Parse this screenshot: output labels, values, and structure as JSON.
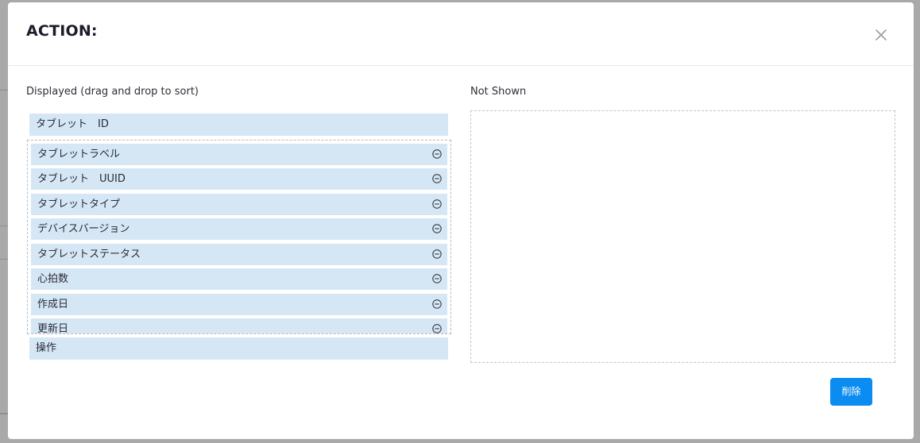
{
  "modal": {
    "title": "ACTION:",
    "close_icon": "close-icon"
  },
  "displayed": {
    "label": "Displayed (drag and drop to sort)",
    "fixed_top": "タブレット　ID",
    "items": [
      {
        "label": "タブレットラベル"
      },
      {
        "label": "タブレット　UUID"
      },
      {
        "label": "タブレットタイプ"
      },
      {
        "label": "デバイスバージョン"
      },
      {
        "label": "タブレットステータス"
      },
      {
        "label": "心拍数"
      },
      {
        "label": "作成日"
      },
      {
        "label": "更新日"
      }
    ],
    "fixed_bottom": "操作",
    "remove_icon": "minus-circle-icon"
  },
  "not_shown": {
    "label": "Not Shown",
    "items": []
  },
  "footer": {
    "delete_label": "削除"
  },
  "colors": {
    "item_bg": "#d5e7f5",
    "primary_button": "#0a8cf0",
    "overlay": "#a9a9a9"
  }
}
